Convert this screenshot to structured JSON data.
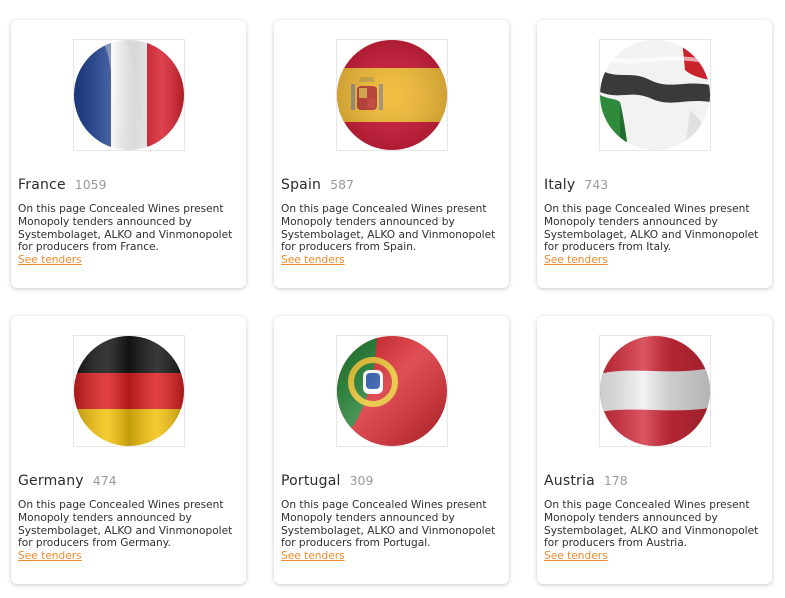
{
  "cards": [
    {
      "country": "France",
      "count": "1059",
      "description": "On this page Concealed Wines present Monopoly tenders announced by Systembolaget, ALKO and Vinmonopolet for producers from France.",
      "link_label": "See tenders",
      "flag_icon": "france-flag-icon"
    },
    {
      "country": "Spain",
      "count": "587",
      "description": "On this page Concealed Wines present Monopoly tenders announced by Systembolaget, ALKO and Vinmonopolet for producers from Spain.",
      "link_label": "See tenders",
      "flag_icon": "spain-flag-icon"
    },
    {
      "country": "Italy",
      "count": "743",
      "description": "On this page Concealed Wines present Monopoly tenders announced by Systembolaget, ALKO and Vinmonopolet for producers from Italy.",
      "link_label": "See tenders",
      "flag_icon": "italy-flag-icon"
    },
    {
      "country": "Germany",
      "count": "474",
      "description": "On this page Concealed Wines present Monopoly tenders announced by Systembolaget, ALKO and Vinmonopolet for producers from Germany.",
      "link_label": "See tenders",
      "flag_icon": "germany-flag-icon"
    },
    {
      "country": "Portugal",
      "count": "309",
      "description": "On this page Concealed Wines present Monopoly tenders announced by Systembolaget, ALKO and Vinmonopolet for producers from Portugal.",
      "link_label": "See tenders",
      "flag_icon": "portugal-flag-icon"
    },
    {
      "country": "Austria",
      "count": "178",
      "description": "On this page Concealed Wines present Monopoly tenders announced by Systembolaget, ALKO and Vinmonopolet for producers from Austria.",
      "link_label": "See tenders",
      "flag_icon": "austria-flag-icon"
    }
  ],
  "colors": {
    "link": "#f08a2c",
    "text": "#2f2f2f",
    "count": "#9a9a9a"
  }
}
